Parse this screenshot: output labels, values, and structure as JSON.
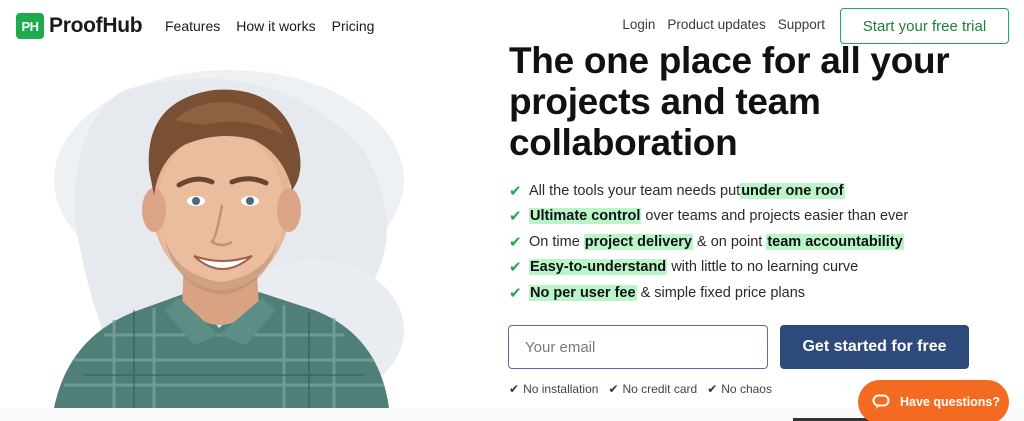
{
  "brand": {
    "badge": "PH",
    "name": "ProofHub",
    "color": "#1eaa4f"
  },
  "nav": {
    "left": [
      "Features",
      "How it works",
      "Pricing"
    ],
    "right": [
      "Login",
      "Product updates",
      "Support"
    ],
    "trial_button": "Start your free trial"
  },
  "hero": {
    "headline": "The one place for all your projects and team collaboration",
    "features": [
      {
        "before": "All the tools your team needs put ",
        "highlight": "under one roof",
        "after": ""
      },
      {
        "before": "",
        "highlight": "Ultimate control",
        "after": " over teams and projects easier than ever"
      },
      {
        "before": "On time ",
        "highlight": "project delivery",
        "after": " & on point ",
        "highlight2": "team accountability"
      },
      {
        "before": "",
        "highlight": "Easy-to-understand",
        "after": " with little to no learning curve"
      },
      {
        "before": "",
        "highlight": "No per user fee",
        "after": " & simple fixed price plans"
      }
    ],
    "email_placeholder": "Your email",
    "cta_button": "Get started for free",
    "assurances": [
      "No installation",
      "No credit card",
      "No chaos"
    ]
  },
  "chat": {
    "label": "Have questions?",
    "color": "#f26b21",
    "icon": "chat-bubble-icon"
  },
  "colors": {
    "accent": "#1eaa4f",
    "highlight_bg": "#b9f5c8",
    "cta": "#2d4a7b"
  }
}
